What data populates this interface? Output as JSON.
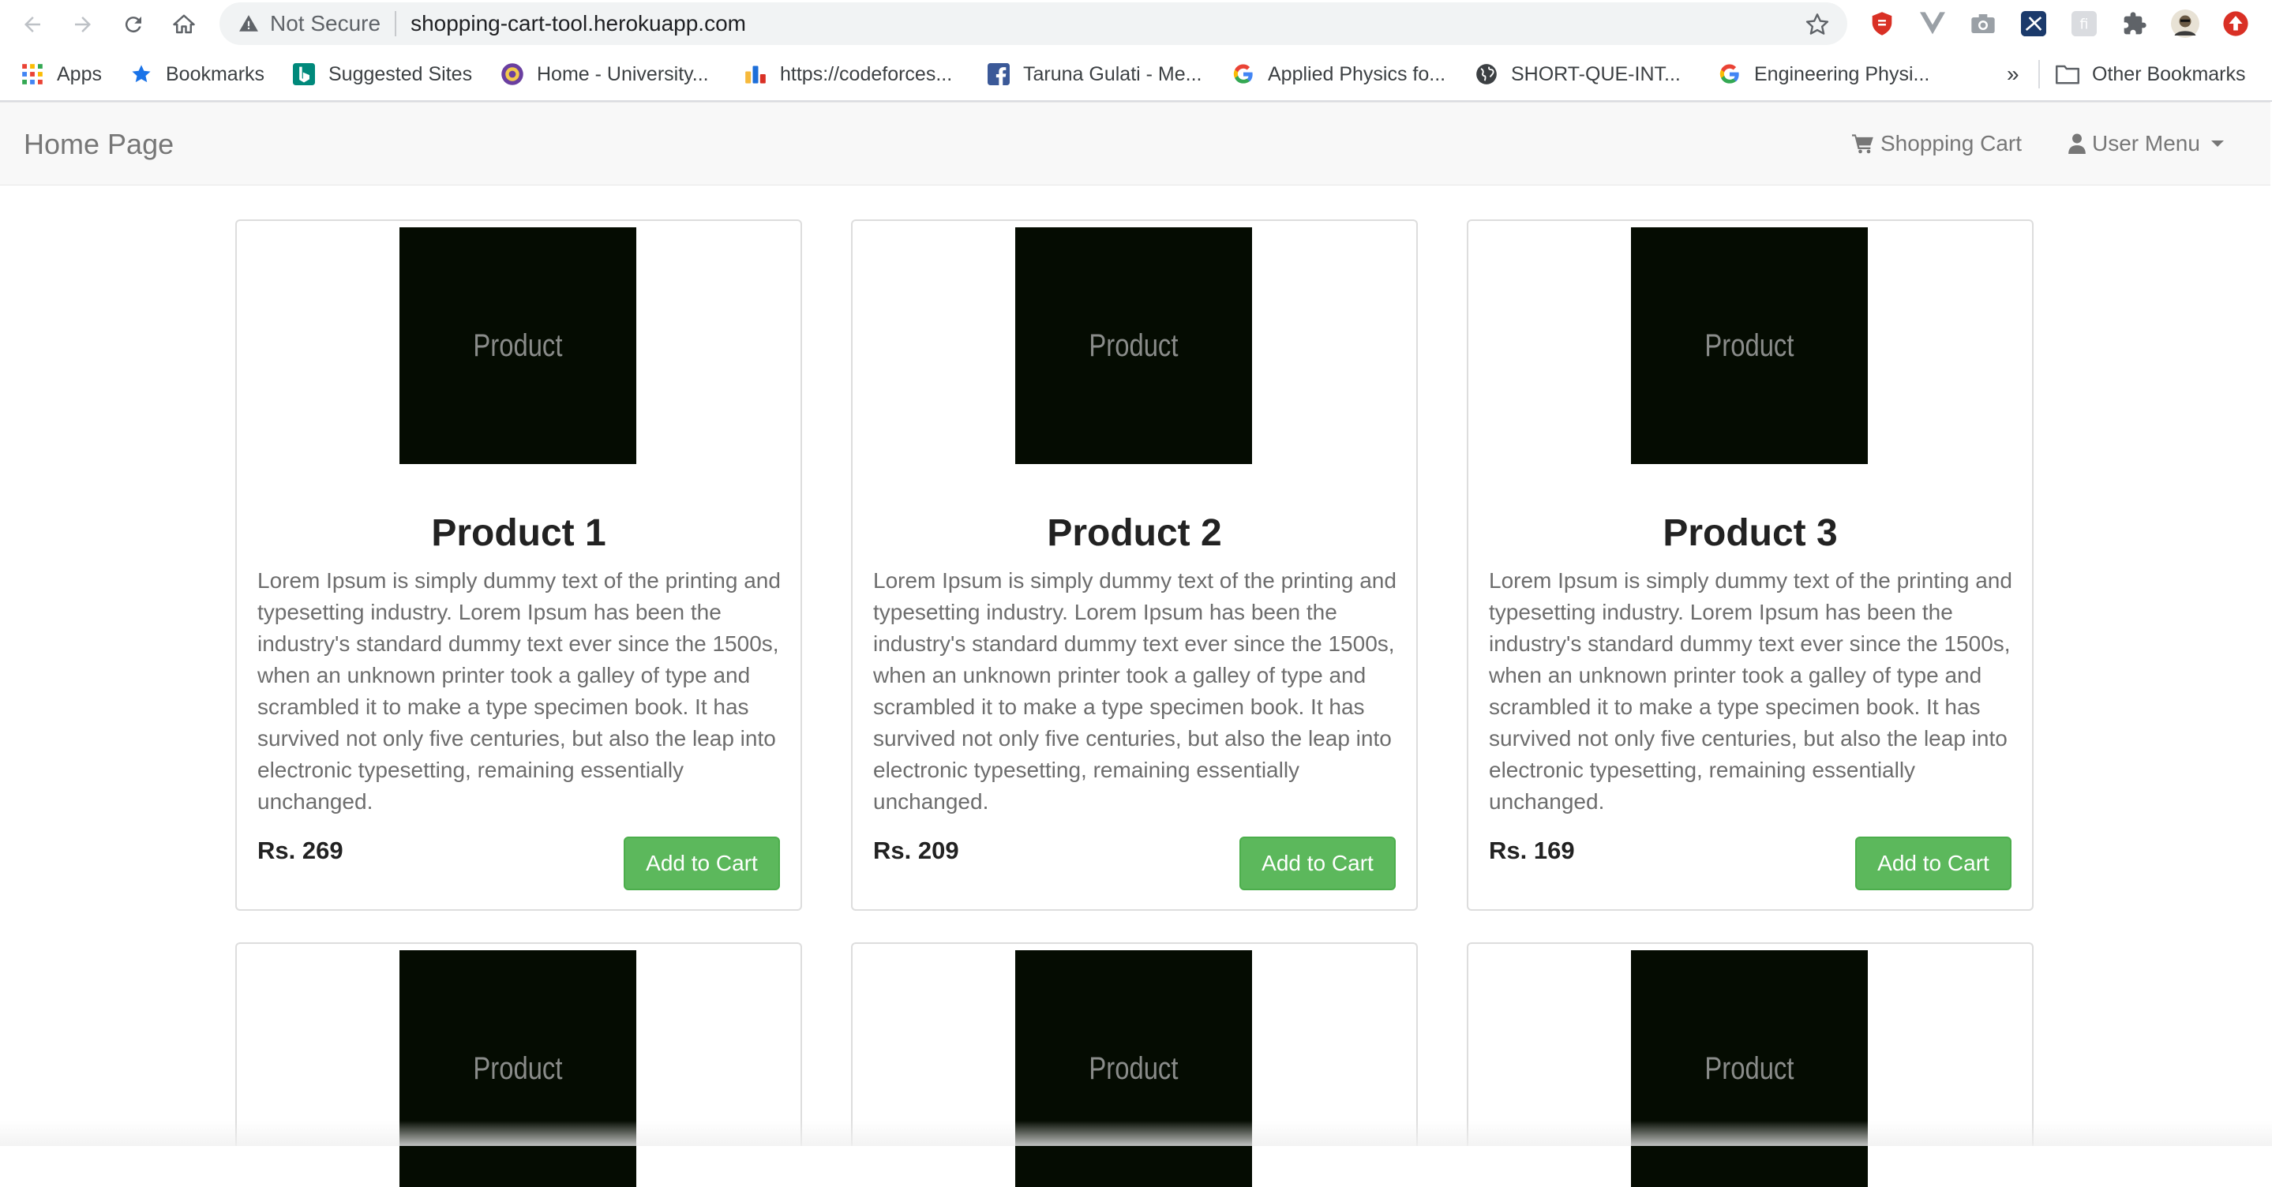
{
  "browser": {
    "security_label": "Not Secure",
    "url": "shopping-cart-tool.herokuapp.com",
    "bookmarks": [
      {
        "label": "Apps",
        "icon": "apps-grid-icon"
      },
      {
        "label": "Bookmarks",
        "icon": "star-icon"
      },
      {
        "label": "Suggested Sites",
        "icon": "bing-icon"
      },
      {
        "label": "Home - University...",
        "icon": "university-icon"
      },
      {
        "label": "https://codeforces...",
        "icon": "codeforces-icon"
      },
      {
        "label": "Taruna Gulati - Me...",
        "icon": "facebook-icon"
      },
      {
        "label": "Applied Physics fo...",
        "icon": "google-icon"
      },
      {
        "label": "SHORT-QUE-INT...",
        "icon": "globe-icon"
      },
      {
        "label": "Engineering Physi...",
        "icon": "google-icon"
      }
    ],
    "overflow_label": "»",
    "other_bookmarks": "Other Bookmarks"
  },
  "navbar": {
    "brand": "Home Page",
    "cart_label": "Shopping Cart",
    "user_menu_label": "User Menu"
  },
  "products": [
    {
      "placeholder": "Product",
      "title": "Product 1",
      "description": "Lorem Ipsum is simply dummy text of the printing and typesetting industry. Lorem Ipsum has been the industry's standard dummy text ever since the 1500s, when an unknown printer took a galley of type and scrambled it to make a type specimen book. It has survived not only five centuries, but also the leap into electronic typesetting, remaining essentially unchanged.",
      "price": "Rs. 269",
      "button": "Add to Cart"
    },
    {
      "placeholder": "Product",
      "title": "Product 2",
      "description": "Lorem Ipsum is simply dummy text of the printing and typesetting industry. Lorem Ipsum has been the industry's standard dummy text ever since the 1500s, when an unknown printer took a galley of type and scrambled it to make a type specimen book. It has survived not only five centuries, but also the leap into electronic typesetting, remaining essentially unchanged.",
      "price": "Rs. 209",
      "button": "Add to Cart"
    },
    {
      "placeholder": "Product",
      "title": "Product 3",
      "description": "Lorem Ipsum is simply dummy text of the printing and typesetting industry. Lorem Ipsum has been the industry's standard dummy text ever since the 1500s, when an unknown printer took a galley of type and scrambled it to make a type specimen book. It has survived not only five centuries, but also the leap into electronic typesetting, remaining essentially unchanged.",
      "price": "Rs. 169",
      "button": "Add to Cart"
    },
    {
      "placeholder": "Product"
    },
    {
      "placeholder": "Product"
    },
    {
      "placeholder": "Product"
    }
  ]
}
